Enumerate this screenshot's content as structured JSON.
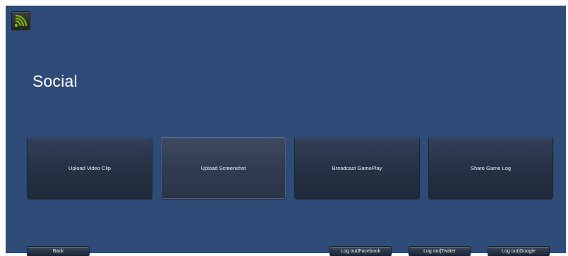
{
  "title": "Social",
  "logo": {
    "icon": "signal-broadcast-icon",
    "color": "#7fb800"
  },
  "actions": {
    "upload_video": "Upload Video Clip",
    "upload_screenshot": "Upload Screenshot",
    "broadcast": "Broadcast GamePlay",
    "share_log": "Share Game Log"
  },
  "footer": {
    "back": "Back",
    "logout_facebook": "Log out|Facebook",
    "logout_twitter": "Log out|Twitter",
    "logout_google": "Log out|Google"
  },
  "colors": {
    "background": "#2f4c78",
    "button": "#263245",
    "accent": "#7fb800"
  }
}
